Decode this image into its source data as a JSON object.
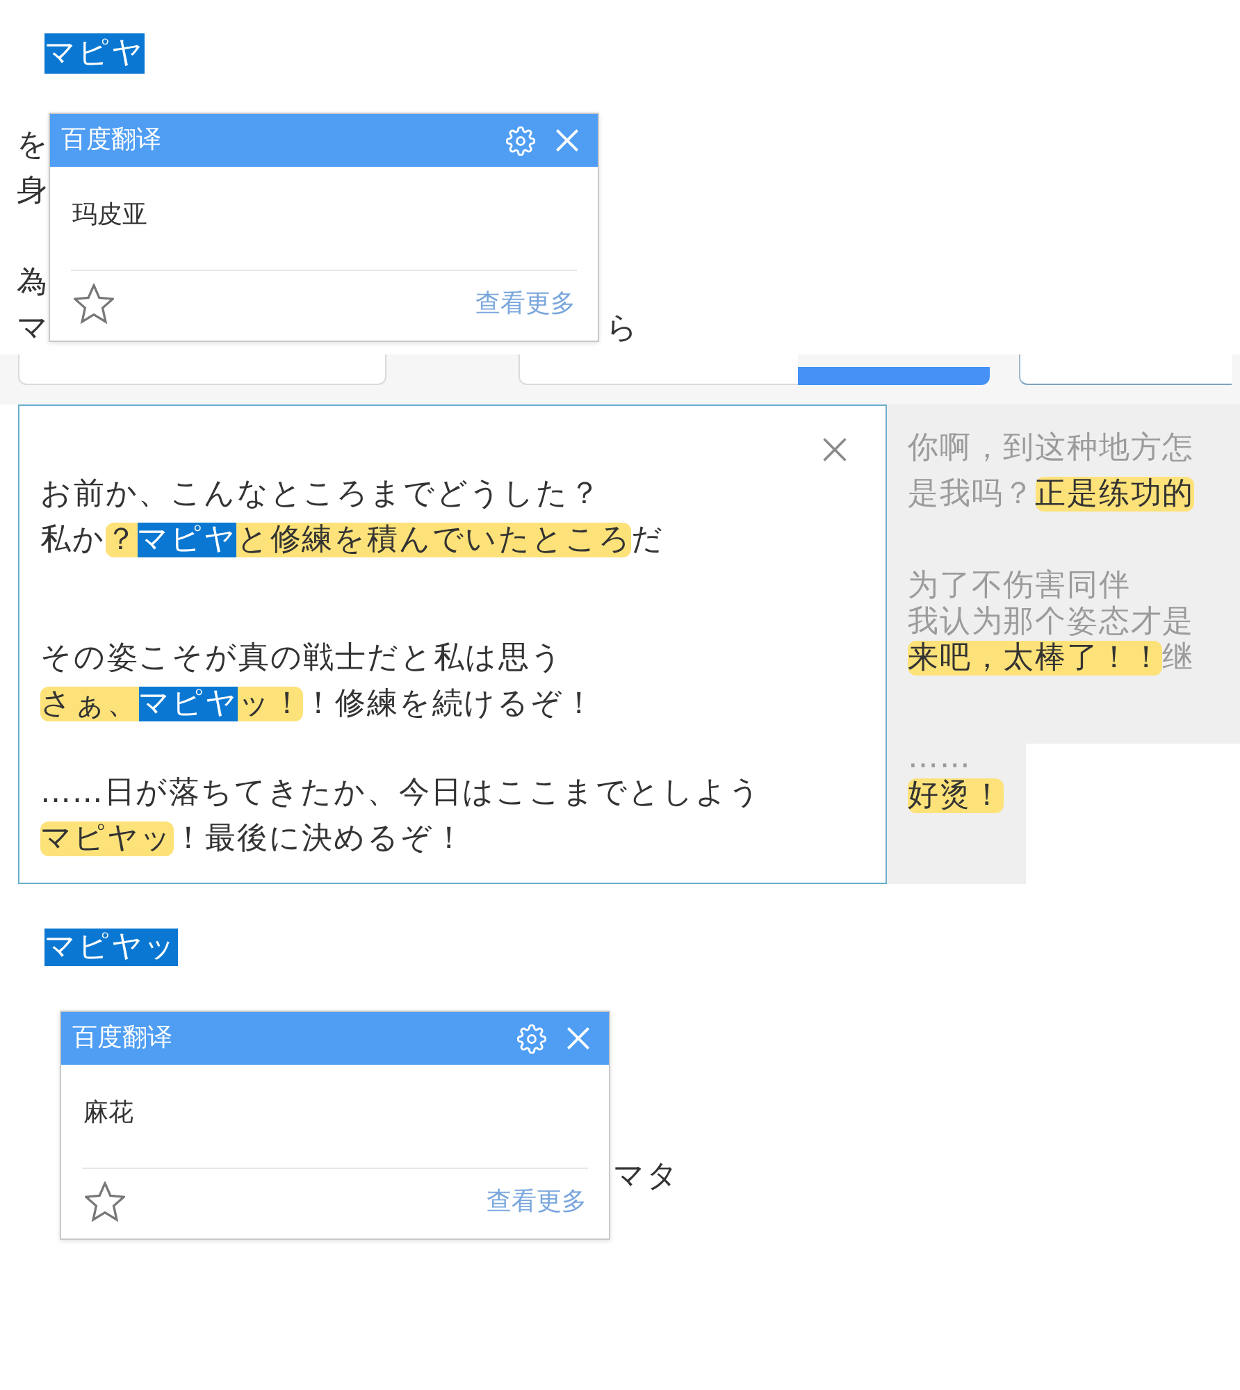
{
  "top_fragment": {
    "selection": {
      "text": "マピヤ",
      "selected": true
    },
    "covered_paragraphs": [
      [
        "を",
        "身"
      ],
      [
        "為",
        "マ"
      ]
    ],
    "right_fragment": "ら",
    "translation_popup": {
      "title": "百度翻译",
      "translation": "玛皮亚",
      "more_link": "查看更多"
    }
  },
  "editor": {
    "source_panel": {
      "paragraphs": [
        {
          "lines": [
            [
              {
                "text": "お前か、こんなところまでどうした？",
                "highlighted": false,
                "selected": false
              }
            ],
            [
              {
                "text": "私か",
                "highlighted": false,
                "selected": false
              },
              {
                "text": "？",
                "highlighted": true,
                "selected": false
              },
              {
                "text": "マピヤ",
                "highlighted": true,
                "selected": true
              },
              {
                "text": "と修練を積んでいたところ",
                "highlighted": true,
                "selected": false
              },
              {
                "text": "だ",
                "highlighted": false,
                "selected": false
              }
            ]
          ]
        },
        {
          "lines": [
            [
              {
                "text": "その姿こそが真の戦士だと私は思う",
                "highlighted": false,
                "selected": false
              }
            ],
            [
              {
                "text": "さぁ、",
                "highlighted": true,
                "selected": false
              },
              {
                "text": "マピヤ",
                "highlighted": true,
                "selected": true
              },
              {
                "text": "ッ！",
                "highlighted": true,
                "selected": false
              },
              {
                "text": "！修練を続けるぞ！",
                "highlighted": false,
                "selected": false
              }
            ]
          ]
        },
        {
          "lines": [
            [
              {
                "text": "……日が落ちてきたか、今日はここまでとしよう",
                "highlighted": false,
                "selected": false
              }
            ],
            [
              {
                "text": "マピヤッ",
                "highlighted": true,
                "selected": false
              },
              {
                "text": "！最後に決めるぞ！",
                "highlighted": false,
                "selected": false
              }
            ]
          ]
        }
      ]
    },
    "translation_panel": {
      "paragraphs": [
        {
          "lines": [
            [
              {
                "text": "你啊，到这种地方怎",
                "highlighted": false
              }
            ],
            [
              {
                "text": "是我吗？",
                "highlighted": false
              },
              {
                "text": "正是练功的",
                "highlighted": true
              }
            ]
          ]
        },
        {
          "lines": [
            [
              {
                "text": "为了不伤害同伴",
                "highlighted": false
              }
            ],
            [
              {
                "text": "我认为那个姿态才是",
                "highlighted": false
              }
            ],
            [
              {
                "text": "来吧，太棒了！！",
                "highlighted": true
              },
              {
                "text": "继",
                "highlighted": false
              }
            ]
          ]
        }
      ],
      "lower_paragraph": {
        "lines": [
          [
            {
              "text": "……",
              "highlighted": false
            }
          ],
          [
            {
              "text": "好烫！",
              "highlighted": true
            }
          ]
        ]
      }
    }
  },
  "bottom_fragment": {
    "selection": {
      "text": "マピヤッ",
      "selected": true
    },
    "right_fragment": "マタ",
    "translation_popup": {
      "title": "百度翻译",
      "translation": "麻花",
      "more_link": "查看更多"
    }
  }
}
